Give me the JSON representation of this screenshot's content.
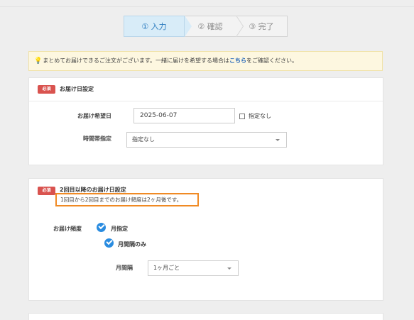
{
  "steps": [
    "① 入力",
    "② 確認",
    "③ 完了"
  ],
  "notice": {
    "text_before": "まとめてお届けできるご注文がございます。一緒に届けを希望する場合は",
    "link": "こちら",
    "text_after": "をご確認ください。"
  },
  "section1": {
    "badge": "必須",
    "title": "お届け日設定",
    "date_label": "お届け希望日",
    "date_value": "2025-06-07",
    "no_date_label": "指定なし",
    "time_label": "時間帯指定",
    "time_value": "指定なし"
  },
  "section2": {
    "badge": "必須",
    "title": "2回目以降のお届け日設定",
    "hint": "1回目から2回目までのお届け頻度は2ヶ月後です。",
    "freq_label": "お届け頻度",
    "option_month": "月指定",
    "option_interval": "月間隔のみ",
    "interval_label": "月間隔",
    "interval_value": "1ヶ月ごと"
  },
  "colors": {
    "accent": "#2a8ce0",
    "required_badge": "#d9534f",
    "highlight_border": "#f08a24",
    "notice_bg": "#fdf7e0",
    "link": "#1f63b8"
  }
}
